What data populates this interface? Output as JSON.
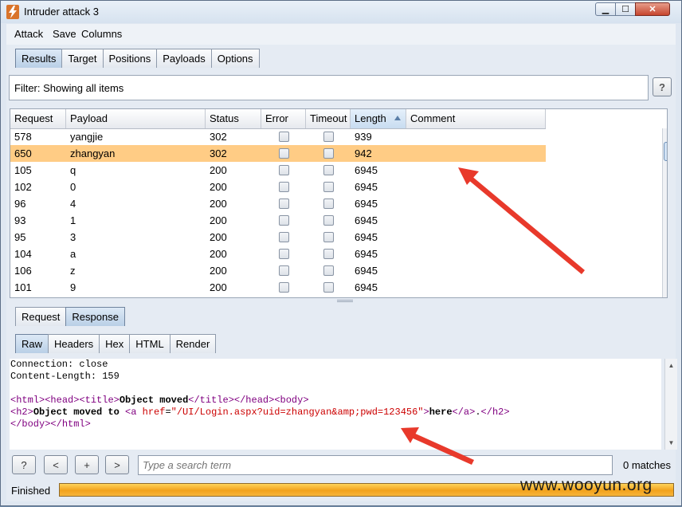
{
  "window": {
    "title": "Intruder attack 3"
  },
  "menu": [
    "Attack",
    "Save",
    "Columns"
  ],
  "main_tabs": [
    {
      "label": "Results",
      "active": true
    },
    {
      "label": "Target",
      "active": false
    },
    {
      "label": "Positions",
      "active": false
    },
    {
      "label": "Payloads",
      "active": false
    },
    {
      "label": "Options",
      "active": false
    }
  ],
  "filter": {
    "text": "Filter: Showing all items",
    "help": "?"
  },
  "table": {
    "columns": [
      "Request",
      "Payload",
      "Status",
      "Error",
      "Timeout",
      "Length",
      "Comment"
    ],
    "sorted_column": "Length",
    "rows": [
      {
        "request": "578",
        "payload": "yangjie",
        "status": "302",
        "error": false,
        "timeout": false,
        "length": "939",
        "comment": "",
        "selected": false
      },
      {
        "request": "650",
        "payload": "zhangyan",
        "status": "302",
        "error": false,
        "timeout": false,
        "length": "942",
        "comment": "",
        "selected": true
      },
      {
        "request": "105",
        "payload": "q",
        "status": "200",
        "error": false,
        "timeout": false,
        "length": "6945",
        "comment": "",
        "selected": false
      },
      {
        "request": "102",
        "payload": "0",
        "status": "200",
        "error": false,
        "timeout": false,
        "length": "6945",
        "comment": "",
        "selected": false
      },
      {
        "request": "96",
        "payload": "4",
        "status": "200",
        "error": false,
        "timeout": false,
        "length": "6945",
        "comment": "",
        "selected": false
      },
      {
        "request": "93",
        "payload": "1",
        "status": "200",
        "error": false,
        "timeout": false,
        "length": "6945",
        "comment": "",
        "selected": false
      },
      {
        "request": "95",
        "payload": "3",
        "status": "200",
        "error": false,
        "timeout": false,
        "length": "6945",
        "comment": "",
        "selected": false
      },
      {
        "request": "104",
        "payload": "a",
        "status": "200",
        "error": false,
        "timeout": false,
        "length": "6945",
        "comment": "",
        "selected": false
      },
      {
        "request": "106",
        "payload": "z",
        "status": "200",
        "error": false,
        "timeout": false,
        "length": "6945",
        "comment": "",
        "selected": false
      },
      {
        "request": "101",
        "payload": "9",
        "status": "200",
        "error": false,
        "timeout": false,
        "length": "6945",
        "comment": "",
        "selected": false
      }
    ]
  },
  "detail_tabs": [
    {
      "label": "Request",
      "active": false
    },
    {
      "label": "Response",
      "active": true
    }
  ],
  "view_tabs": [
    {
      "label": "Raw",
      "active": true
    },
    {
      "label": "Headers",
      "active": false
    },
    {
      "label": "Hex",
      "active": false
    },
    {
      "label": "HTML",
      "active": false
    },
    {
      "label": "Render",
      "active": false
    }
  ],
  "response": {
    "line1": "Connection: close",
    "line2": "Content-Length: 159",
    "html_open": "<html>",
    "head_open": "<head>",
    "title_open": "<title>",
    "title_text": "Object moved",
    "title_close": "</title>",
    "head_close": "</head>",
    "body_open": "<body>",
    "h2_open": "<h2>",
    "h2_text": "Object moved to ",
    "a_open": "<a ",
    "href_attr": "href",
    "href_eq": "=",
    "href_value": "\"/UI/Login.aspx?uid=zhangyan&amp;pwd=123456\"",
    "a_gt": ">",
    "link_text": "here",
    "a_close": "</a>",
    "dot": ".",
    "h2_close": "</h2>",
    "body_close": "</body>",
    "html_close": "</html>"
  },
  "bottom": {
    "help": "?",
    "prev": "<",
    "add": "+",
    "next": ">",
    "search_placeholder": "Type a search term",
    "matches": "0 matches"
  },
  "status": {
    "text": "Finished",
    "progress": 1.0
  },
  "watermark": "www.wooyun.org",
  "colors": {
    "selected_row": "#ffcc85",
    "arrow": "#e8392b",
    "progress": "#f2a21c"
  }
}
